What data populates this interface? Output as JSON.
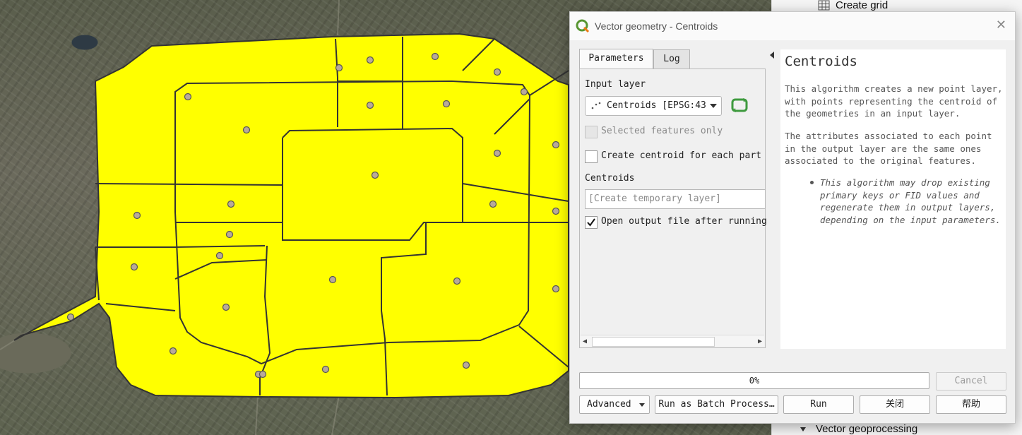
{
  "dialog": {
    "title": "Vector geometry - Centroids",
    "tabs": [
      {
        "label": "Parameters",
        "active": true
      },
      {
        "label": "Log",
        "active": false
      }
    ],
    "params": {
      "input_layer_label": "Input layer",
      "input_layer_value": "Centroids [EPSG:43",
      "selected_only_label": "Selected features only",
      "selected_only_checked": false,
      "centroid_each_part_label": "Create centroid for each part",
      "centroid_each_part_checked": false,
      "output_label": "Centroids",
      "output_placeholder": "[Create temporary layer]",
      "open_output_label": "Open output file after running",
      "open_output_checked": true
    },
    "help": {
      "title": "Centroids",
      "para1": "This algorithm creates a new point layer, with points representing the centroid of the geometries in an input layer.",
      "para2": "The attributes associated to each point in the output layer are the same ones associated to the original features.",
      "note": "This algorithm may drop existing primary keys or FID values and regenerate them in output layers, depending on the input parameters."
    },
    "progress": {
      "text": "0%",
      "value": 0
    },
    "buttons": {
      "cancel": "Cancel",
      "advanced": "Advanced",
      "batch": "Run as Batch Process…",
      "run": "Run",
      "close": "关闭",
      "help": "帮助"
    }
  },
  "toolbox": {
    "create_grid": "Create grid",
    "vector_geoprocessing": "Vector geoprocessing"
  },
  "map": {
    "polygon_fill": "#ffff00",
    "outline_color": "#333333",
    "point_color": "#b8a99a"
  }
}
